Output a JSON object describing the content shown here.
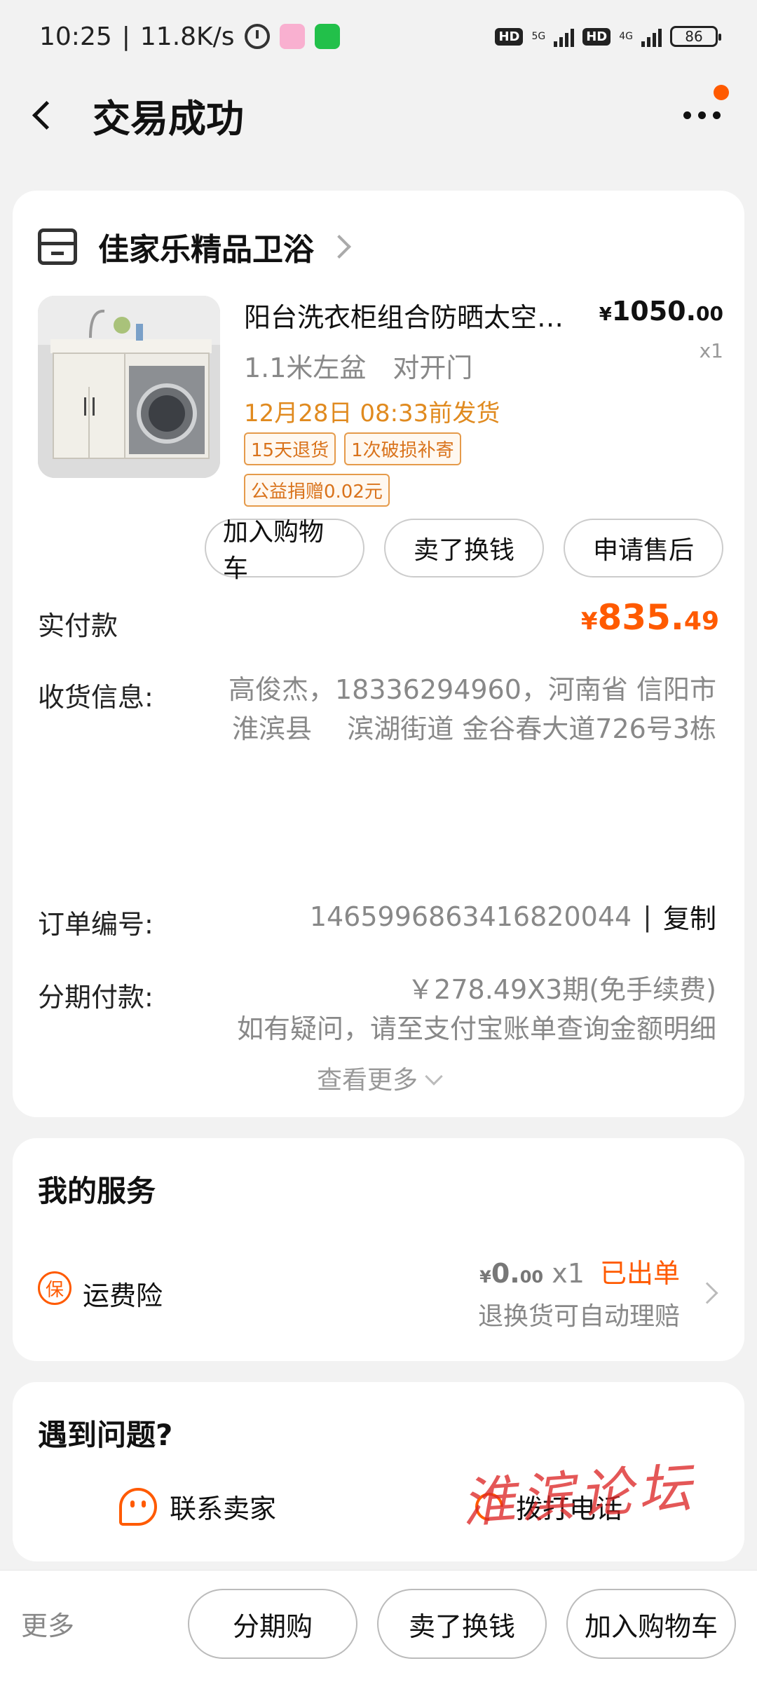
{
  "status_bar": {
    "time": "10:25",
    "speed": "11.8K/s",
    "hd1": "HD",
    "net1": "5G",
    "hd2": "HD",
    "net2": "4G",
    "battery": "86"
  },
  "nav": {
    "title": "交易成功"
  },
  "order": {
    "shop_name": "佳家乐精品卫浴",
    "product": {
      "title": "阳台洗衣柜组合防晒太空…",
      "price_currency": "¥",
      "price_int": "1050.",
      "price_dec": "00",
      "quantity": "x1",
      "spec": "1.1米左盆　对开门",
      "ship_time": "12月28日 08:33前发货",
      "tags": [
        "15天退货",
        "1次破损补寄",
        "公益捐赠0.02元"
      ]
    },
    "actions": [
      "加入购物车",
      "卖了换钱",
      "申请售后"
    ],
    "paid_label": "实付款",
    "paid_currency": "¥",
    "paid_int": "835.",
    "paid_dec": "49",
    "address_label": "收货信息:",
    "address_value": "高俊杰，18336294960，河南省 信阳市 淮滨县　 滨湖街道 金谷春大道726号3栋",
    "order_no_label": "订单编号:",
    "order_no": "1465996863416820044",
    "order_sep": "|",
    "copy_label": "复制",
    "installment_label": "分期付款:",
    "installment_value": "￥278.49X3期(免手续费)",
    "installment_note": "如有疑问，请至支付宝账单查询金额明细",
    "see_more": "查看更多"
  },
  "service": {
    "title": "我的服务",
    "icon_char": "保",
    "name": "运费险",
    "price_currency": "¥",
    "price_int": "0.",
    "price_dec": "00",
    "qty": "x1",
    "status": "已出单",
    "note": "退换货可自动理赔"
  },
  "help": {
    "title": "遇到问题?",
    "contact_seller": "联系卖家",
    "call_phone": "拨打电话",
    "watermark": "淮滨论坛"
  },
  "bottom": {
    "more": "更多",
    "buttons": [
      "分期购",
      "卖了换钱",
      "加入购物车"
    ]
  },
  "colors": {
    "accent": "#ff5a00",
    "ship_text": "#e08a1f",
    "tag_border": "#e59a4a",
    "background": "#f2f2f2"
  }
}
